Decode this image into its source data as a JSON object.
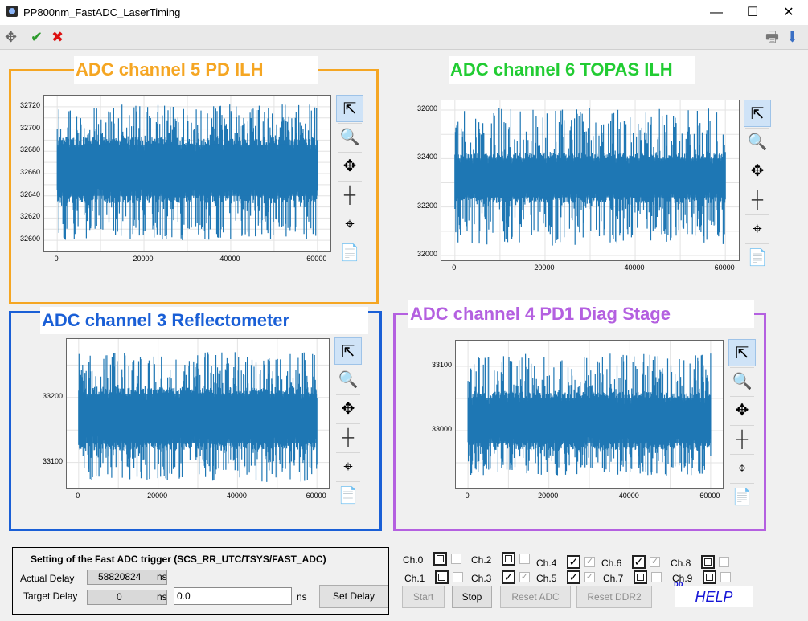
{
  "window": {
    "title": "PP800nm_FastADC_LaserTiming",
    "minimize": "—",
    "maximize": "☐",
    "close": "✕"
  },
  "toolbar": {
    "icon_move": "✥",
    "icon_ok": "✔",
    "icon_cancel": "✖",
    "icon_print": "🖶",
    "icon_save": "⬇"
  },
  "colors": {
    "orange": "#f5a623",
    "green": "#22cc33",
    "blue": "#1a5fd6",
    "purple": "#b460e0",
    "trace": "#1f77b4"
  },
  "plots": [
    {
      "title": "ADC channel 5 PD ILH",
      "title_color": "#f5a623",
      "yticks": [
        "32720",
        "32700",
        "32680",
        "32660",
        "32640",
        "32620",
        "32600"
      ],
      "xticks": [
        "0",
        "20000",
        "40000",
        "60000"
      ],
      "chart_data": {
        "type": "line",
        "ylim": [
          32590,
          32730
        ],
        "xlim": [
          -3000,
          63000
        ],
        "x_range": [
          0,
          60000
        ],
        "center": 32663,
        "band": [
          32640,
          32686
        ],
        "spike_range": [
          32600,
          32722
        ]
      }
    },
    {
      "title": "ADC channel 6 TOPAS ILH",
      "title_color": "#22cc33",
      "yticks": [
        "32600",
        "32400",
        "32200",
        "32000"
      ],
      "xticks": [
        "0",
        "20000",
        "40000",
        "60000"
      ],
      "chart_data": {
        "type": "line",
        "ylim": [
          31980,
          32640
        ],
        "xlim": [
          -3000,
          63000
        ],
        "x_range": [
          0,
          60000
        ],
        "center": 32318,
        "band": [
          32240,
          32400
        ],
        "spike_range": [
          32040,
          32610
        ]
      }
    },
    {
      "title": "ADC channel 3 Reflectometer",
      "title_color": "#1a5fd6",
      "yticks": [
        "33200",
        "33100"
      ],
      "xticks": [
        "0",
        "20000",
        "40000",
        "60000"
      ],
      "chart_data": {
        "type": "line",
        "ylim": [
          33060,
          33290
        ],
        "xlim": [
          -3000,
          63000
        ],
        "x_range": [
          0,
          60000
        ],
        "center": 33165,
        "band": [
          33130,
          33205
        ],
        "spike_range": [
          33070,
          33270
        ]
      }
    },
    {
      "title": "ADC channel 4 PD1 Diag Stage",
      "title_color": "#b460e0",
      "yticks": [
        "33100",
        "33000"
      ],
      "xticks": [
        "0",
        "20000",
        "40000",
        "60000"
      ],
      "chart_data": {
        "type": "line",
        "ylim": [
          32910,
          33140
        ],
        "xlim": [
          -3000,
          63000
        ],
        "x_range": [
          0,
          60000
        ],
        "center": 33015,
        "band": [
          32980,
          33050
        ],
        "spike_range": [
          32930,
          33120
        ]
      }
    }
  ],
  "tools": {
    "pointer": "⇱",
    "zoom": "🔍",
    "pan": "✥",
    "cross": "┼",
    "target": "⌖",
    "export": "📄"
  },
  "settings": {
    "title": "Setting of the Fast ADC trigger (SCS_RR_UTC/TSYS/FAST_ADC)",
    "actual_label": "Actual Delay",
    "actual_value": "58820824",
    "target_label": "Target Delay",
    "target_value": "0",
    "unit": "ns",
    "input_value": "0.0",
    "set_button": "Set Delay"
  },
  "channels": [
    {
      "label": "Ch.0",
      "checked": false
    },
    {
      "label": "Ch.1",
      "checked": false
    },
    {
      "label": "Ch.2",
      "checked": false
    },
    {
      "label": "Ch.3",
      "checked": true
    },
    {
      "label": "Ch.4",
      "checked": true
    },
    {
      "label": "Ch.5",
      "checked": true
    },
    {
      "label": "Ch.6",
      "checked": true
    },
    {
      "label": "Ch.7",
      "checked": false
    },
    {
      "label": "Ch.8",
      "checked": false
    },
    {
      "label": "Ch.9",
      "checked": false
    }
  ],
  "buttons": {
    "start": "Start",
    "stop": "Stop",
    "reset_adc": "Reset ADC",
    "reset_ddr2": "Reset DDR2"
  },
  "help": "HELP"
}
